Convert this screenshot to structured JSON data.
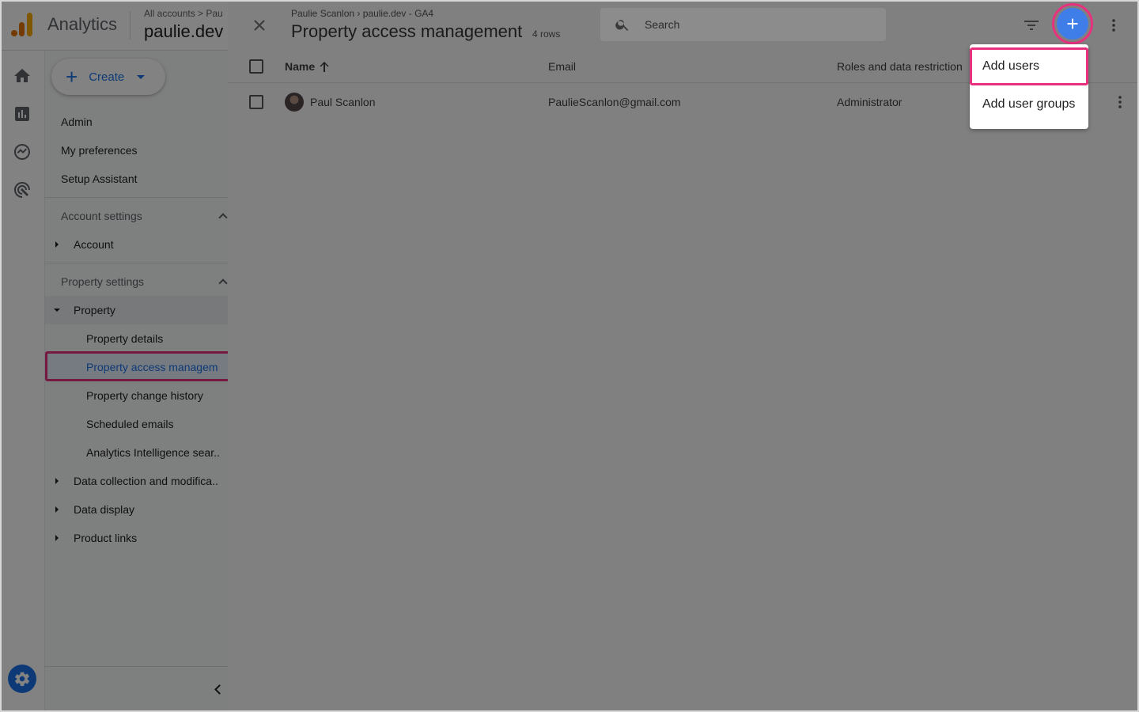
{
  "app": {
    "product_name": "Analytics",
    "breadcrumb": "All accounts > Pau",
    "property_name": "paulie.dev"
  },
  "sidenav": {
    "create_label": "Create",
    "items": [
      {
        "label": "Admin"
      },
      {
        "label": "My preferences"
      },
      {
        "label": "Setup Assistant"
      },
      {
        "label": "Account settings"
      },
      {
        "label": "Account"
      },
      {
        "label": "Property settings"
      },
      {
        "label": "Property"
      },
      {
        "label": "Property details"
      },
      {
        "label": "Property access managem"
      },
      {
        "label": "Property change history"
      },
      {
        "label": "Scheduled emails"
      },
      {
        "label": "Analytics Intelligence sear.."
      },
      {
        "label": "Data collection and modifica.."
      },
      {
        "label": "Data display"
      },
      {
        "label": "Product links"
      }
    ]
  },
  "panel": {
    "breadcrumb": "Paulie Scanlon › paulie.dev - GA4",
    "title": "Property access management",
    "row_count": "4 rows",
    "search_placeholder": "Search",
    "columns": {
      "name": "Name",
      "email": "Email",
      "roles": "Roles and data restriction"
    },
    "rows": [
      {
        "name": "Paul Scanlon",
        "email": "PaulieScanlon@gmail.com",
        "role": "Administrator"
      }
    ]
  },
  "menu": {
    "items": [
      {
        "label": "Add users"
      },
      {
        "label": "Add user groups"
      }
    ]
  },
  "colors": {
    "accent": "#1a73e8",
    "highlight": "#e8317e",
    "scrim": "#000000"
  }
}
